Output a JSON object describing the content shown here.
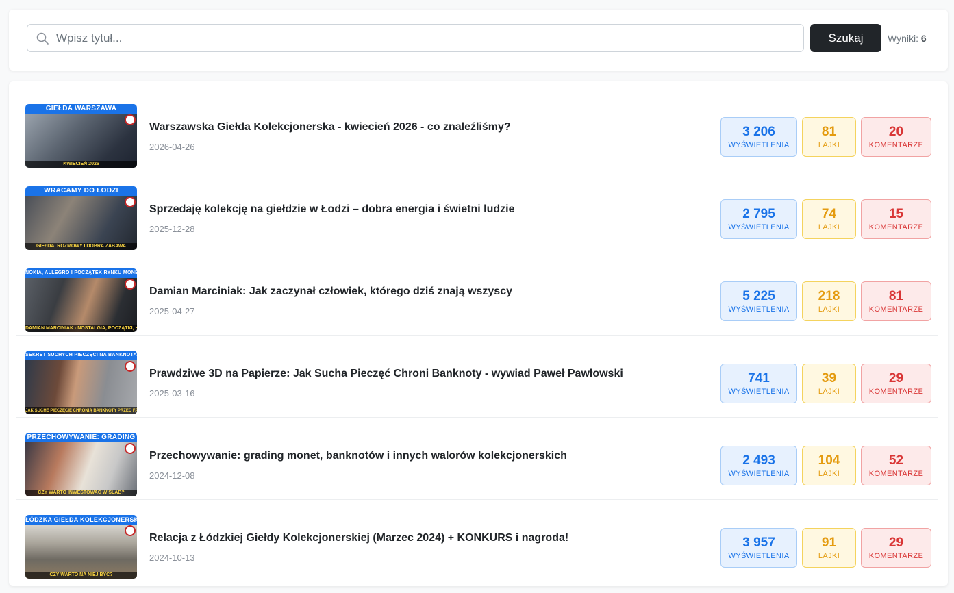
{
  "search": {
    "placeholder": "Wpisz tytuł...",
    "button_label": "Szukaj",
    "results_label": "Wyniki:",
    "results_count": "6"
  },
  "stat_labels": {
    "views": "WYŚWIETLENIA",
    "likes": "LAJKI",
    "comments": "KOMENTARZE"
  },
  "videos": [
    {
      "thumb_banner": "GIEŁDA WARSZAWA",
      "thumb_caption": "KWIECIEŃ 2026",
      "title": "Warszawska Giełda Kolekcjonerska - kwiecień 2026 - co znaleźliśmy?",
      "date": "2026-04-26",
      "views": "3 206",
      "likes": "81",
      "comments": "20"
    },
    {
      "thumb_banner": "WRACAMY DO ŁODZI",
      "thumb_caption": "GIEŁDA, ROZMOWY I DOBRA ZABAWA",
      "title": "Sprzedaję kolekcję na giełdzie w Łodzi – dobra energia i świetni ludzie",
      "date": "2025-12-28",
      "views": "2 795",
      "likes": "74",
      "comments": "15"
    },
    {
      "thumb_banner": "NOKIA, ALLEGRO I POCZĄTEK RYNKU MONET",
      "thumb_caption": "DAMIAN MARCINIAK - NOSTALGIA, POCZĄTKI, HISTORIA",
      "title": "Damian Marciniak: Jak zaczynał człowiek, którego dziś znają wszyscy",
      "date": "2025-04-27",
      "views": "5 225",
      "likes": "218",
      "comments": "81"
    },
    {
      "thumb_banner": "SEKRET SUCHYCH PIECZĘCI NA BANKNOTACH!",
      "thumb_caption": "JAK SUCHE PIECZĘCIE CHRONIĄ BANKNOTY PRZED FAŁSZERZAMI?",
      "title": "Prawdziwe 3D na Papierze: Jak Sucha Pieczęć Chroni Banknoty - wywiad Paweł Pawłowski",
      "date": "2025-03-16",
      "views": "741",
      "likes": "39",
      "comments": "29"
    },
    {
      "thumb_banner": "PRZECHOWYWANIE: GRADING",
      "thumb_caption": "CZY WARTO INWESTOWAĆ W SLAB?",
      "title": "Przechowywanie: grading monet, banknotów i innych walorów kolekcjonerskich",
      "date": "2024-12-08",
      "views": "2 493",
      "likes": "104",
      "comments": "52"
    },
    {
      "thumb_banner": "ŁÓDZKA GIEŁDA KOLEKCJONERSKA",
      "thumb_caption": "CZY WARTO NA NIEJ BYĆ?",
      "title": "Relacja z Łódzkiej Giełdy Kolekcjonerskiej (Marzec 2024) + KONKURS i nagroda!",
      "date": "2024-10-13",
      "views": "3 957",
      "likes": "91",
      "comments": "29"
    }
  ]
}
